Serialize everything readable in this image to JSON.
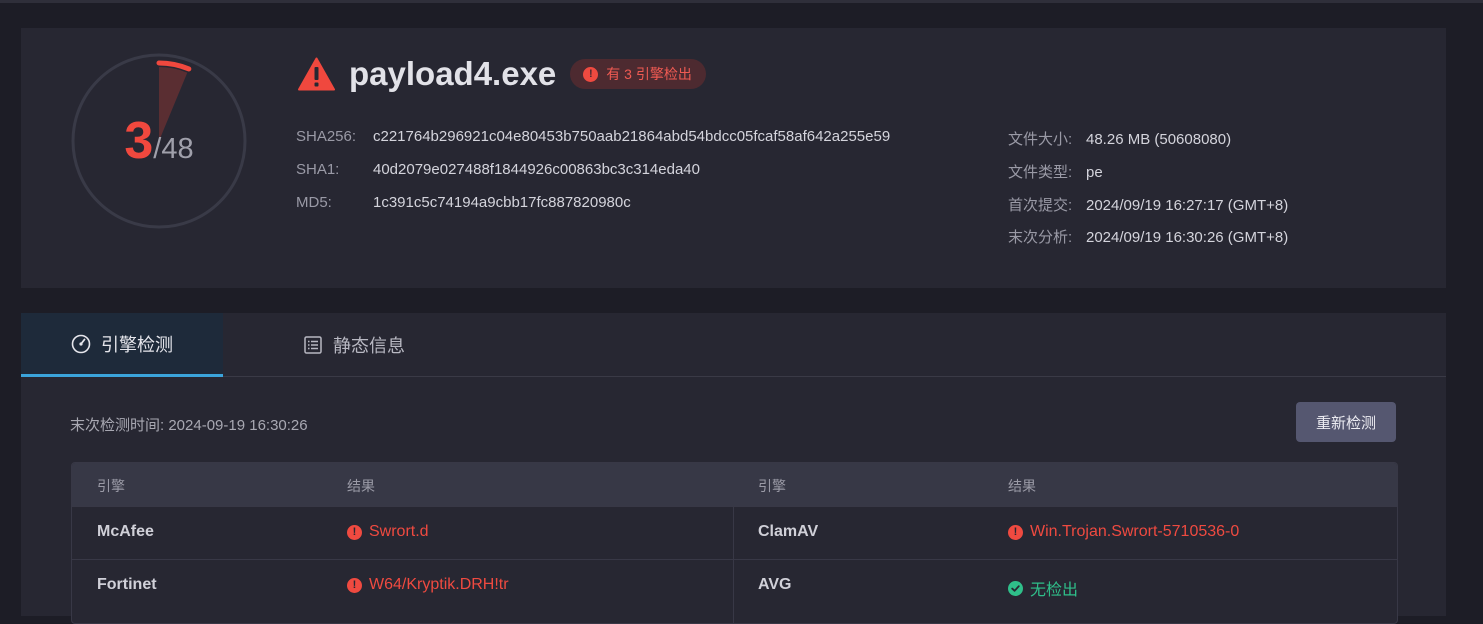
{
  "detection": {
    "count": "3",
    "total": "/48",
    "ratio": 0.0625,
    "color": "#f0483e"
  },
  "file": {
    "name": "payload4.exe",
    "badge": "有 3 引擎检出"
  },
  "hashes": {
    "sha256_label": "SHA256:",
    "sha256": "c221764b296921c04e80453b750aab21864abd54bdcc05fcaf58af642a255e59",
    "sha1_label": "SHA1:",
    "sha1": "40d2079e027488f1844926c00863bc3c314eda40",
    "md5_label": "MD5:",
    "md5": "1c391c5c74194a9cbb17fc887820980c"
  },
  "meta": {
    "size_label": "文件大小:",
    "size": "48.26 MB (50608080)",
    "type_label": "文件类型:",
    "type": "pe",
    "first_label": "首次提交:",
    "first": "2024/09/19 16:27:17 (GMT+8)",
    "last_label": "末次分析:",
    "last": "2024/09/19 16:30:26 (GMT+8)"
  },
  "tabs": [
    {
      "label": "引擎检测",
      "icon": "gauge-icon",
      "active": true
    },
    {
      "label": "静态信息",
      "icon": "list-icon",
      "active": false
    }
  ],
  "scan": {
    "time_label": "末次检测时间: 2024-09-19 16:30:26",
    "rescan_label": "重新检测"
  },
  "table": {
    "headers": [
      "引擎",
      "结果",
      "引擎",
      "结果"
    ],
    "rows": [
      [
        {
          "engine": "McAfee",
          "result": "Swrort.d",
          "status": "detected"
        },
        {
          "engine": "ClamAV",
          "result": "Win.Trojan.Swrort-5710536-0",
          "status": "detected"
        }
      ],
      [
        {
          "engine": "Fortinet",
          "result": "W64/Kryptik.DRH!tr",
          "status": "detected"
        },
        {
          "engine": "AVG",
          "result": "无检出",
          "status": "clean"
        }
      ]
    ]
  },
  "colors": {
    "danger": "#ef4a40",
    "safe": "#2fbf8a",
    "accent": "#3ba4db"
  }
}
